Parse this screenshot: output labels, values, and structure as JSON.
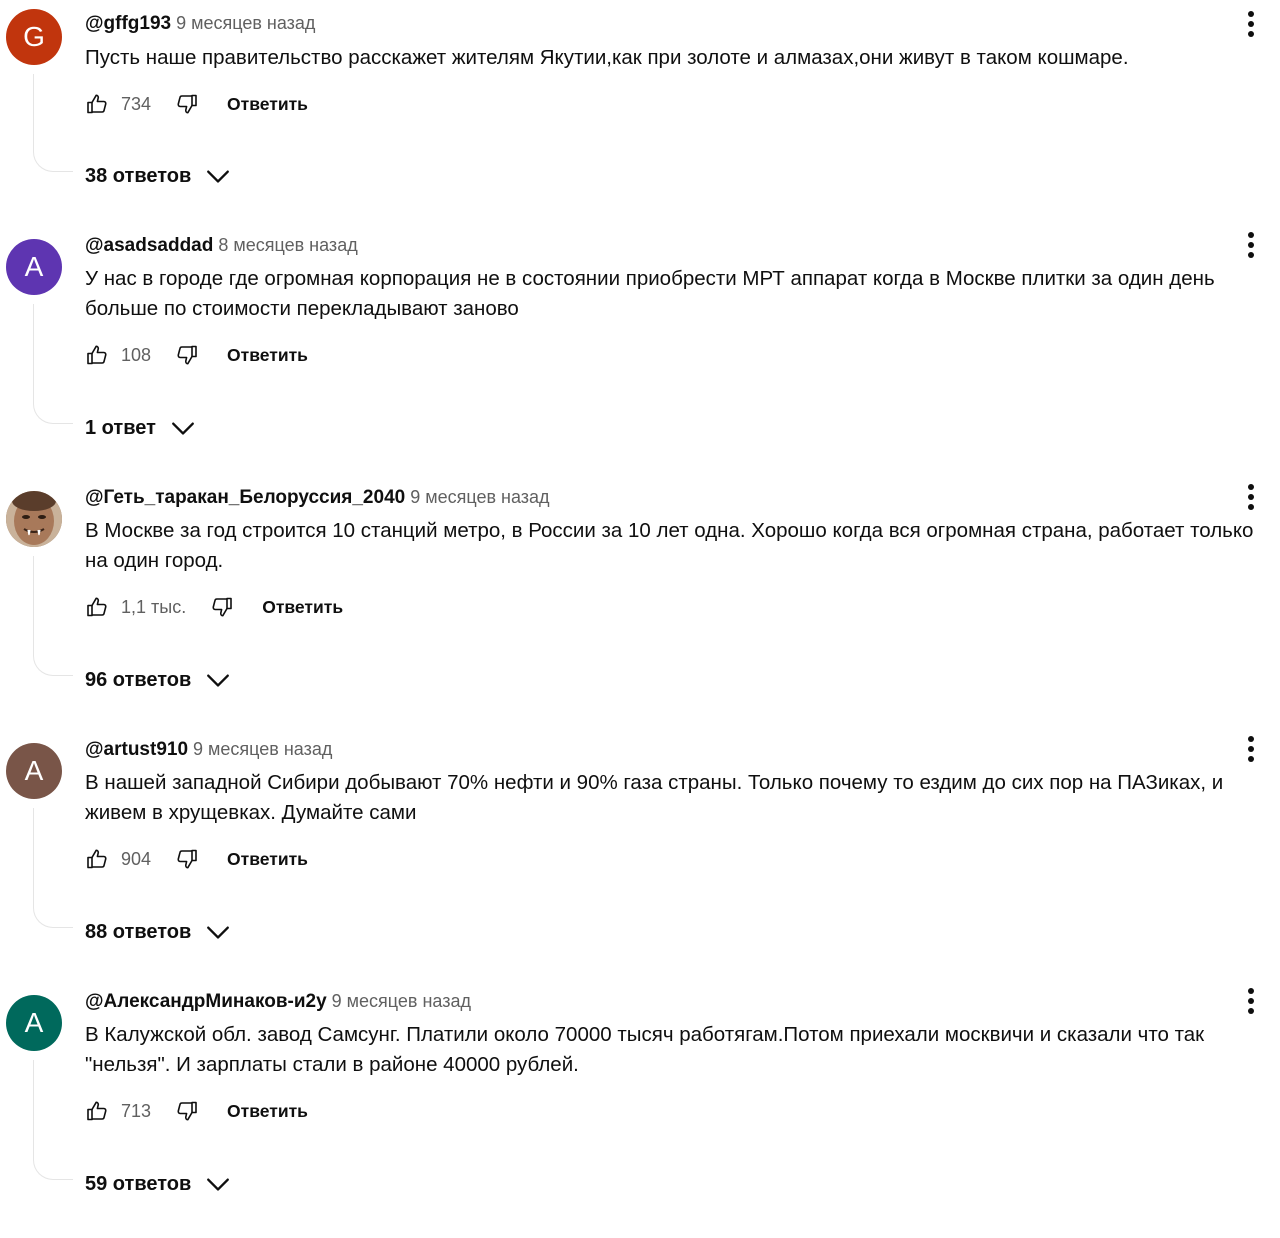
{
  "ui": {
    "reply_label": "Ответить"
  },
  "colors": {
    "accent_text": "#0f0f0f",
    "muted_text": "#606060",
    "thread_line": "#e5e5e5"
  },
  "comments": [
    {
      "author": "@gffg193",
      "time": "9 месяцев назад",
      "avatar_letter": "G",
      "avatar_color": "#c1350d",
      "text": "Пусть наше правительство расскажет жителям Якутии,как при золоте и алмазах,они живут в таком кошмаре.",
      "likes": "734",
      "replies": "38 ответов"
    },
    {
      "author": "@asadsaddad",
      "time": "8 месяцев назад",
      "avatar_letter": "A",
      "avatar_color": "#5e35b1",
      "text": "У нас в городе где огромная корпорация не в состоянии приобрести МРТ аппарат когда в Москве плитки за один день больше по стоимости перекладывают заново",
      "likes": "108",
      "replies": "1 ответ"
    },
    {
      "author": "@Геть_таракан_Белоруссия_2040",
      "time": "9 месяцев назад",
      "avatar_letter": "",
      "avatar_color": "#8a6a52",
      "text": "В Москве за год строится 10 станций метро, в России за 10 лет одна. Хорошо когда вся огромная страна, работает только на один город.",
      "likes": "1,1 тыс.",
      "replies": "96 ответов"
    },
    {
      "author": "@artust910",
      "time": "9 месяцев назад",
      "avatar_letter": "A",
      "avatar_color": "#795548",
      "text": "В нашей западной Сибири добывают 70% нефти и 90% газа страны. Только почему то ездим до сих пор на ПАЗиках, и живем в хрущевках. Думайте сами",
      "likes": "904",
      "replies": "88 ответов"
    },
    {
      "author": "@АлександрМинаков-и2у",
      "time": "9 месяцев назад",
      "avatar_letter": "A",
      "avatar_color": "#00695c",
      "text": "В Калужской обл. завод Самсунг. Платили около 70000 тысяч работягам.Потом приехали москвичи и сказали что так \"нельзя\". И зарплаты стали в районе 40000 рублей.",
      "likes": "713",
      "replies": "59 ответов"
    }
  ]
}
